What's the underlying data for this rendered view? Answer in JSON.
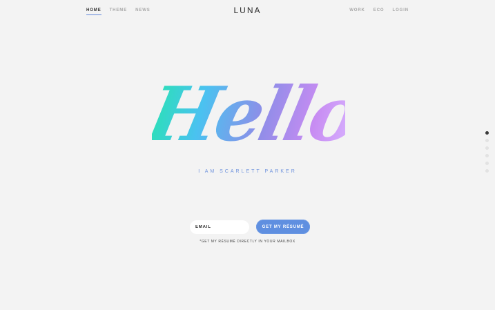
{
  "brand": {
    "logo": "LUNA",
    "accent_color": "#5f8fe0",
    "hello_gradient": [
      "#29e2b3",
      "#4ac2f0",
      "#8f8de8",
      "#c78cf2",
      "#d8b2ff"
    ]
  },
  "nav": {
    "left": [
      {
        "label": "HOME",
        "active": true
      },
      {
        "label": "THEME",
        "active": false
      },
      {
        "label": "NEWS",
        "active": false
      }
    ],
    "right": [
      {
        "label": "WORK",
        "active": false
      },
      {
        "label": "ECO",
        "active": false
      },
      {
        "label": "LOGIN",
        "active": false
      }
    ]
  },
  "hero": {
    "headline": "Hello",
    "subtitle": "I AM SCARLETT PARKER"
  },
  "subscribe": {
    "email_placeholder": "EMAIL",
    "button_label": "GET MY RÉSUMÉ",
    "caption": "*GET MY RÉSUMÉ DIRECTLY IN YOUR MAILBOX"
  },
  "pagination": {
    "count": 6,
    "active_index": 0
  }
}
